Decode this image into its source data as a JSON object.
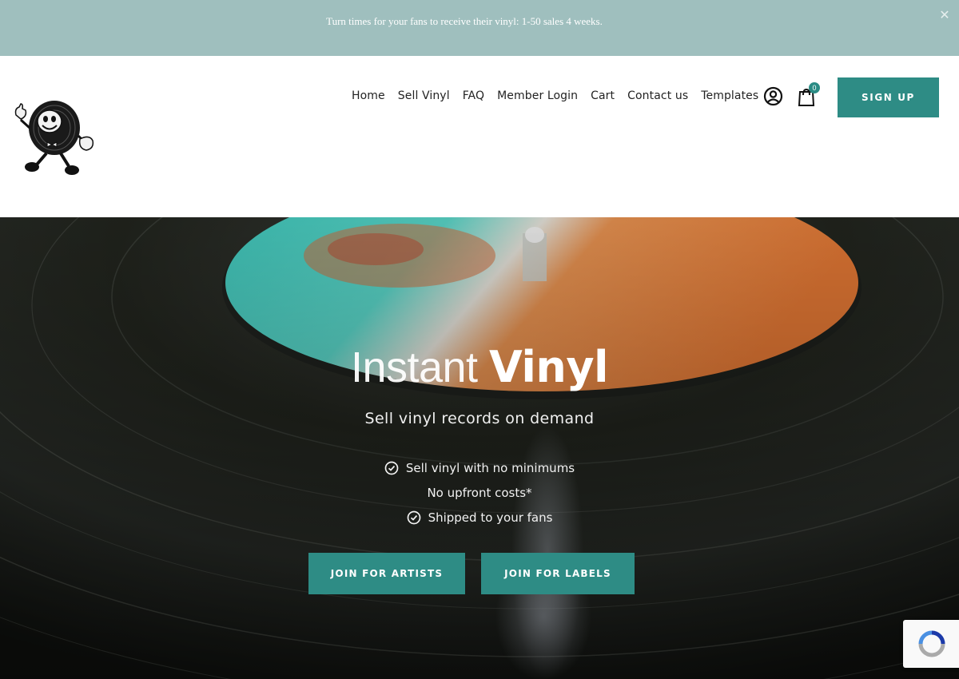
{
  "announcement": {
    "text": "Turn times for your fans to receive their vinyl: 1-50 sales 4 weeks.",
    "close_icon": "close-icon"
  },
  "header": {
    "logo": "record-mascot-logo",
    "nav": [
      "Home",
      "Sell Vinyl",
      "FAQ",
      "Member Login",
      "Cart",
      "Contact us",
      "Templates"
    ],
    "account_icon": "user-circle-icon",
    "cart_icon": "shopping-bag-icon",
    "cart_count": "0",
    "signup_label": "SIGN UP"
  },
  "hero": {
    "title_light": "Instant ",
    "title_bold": "Vinyl",
    "subtitle": "Sell vinyl records on demand",
    "features": [
      {
        "text": "Sell vinyl with no minimums",
        "check": true
      },
      {
        "text": "No upfront costs*",
        "check": false
      },
      {
        "text": "Shipped to your fans",
        "check": true
      }
    ],
    "button_artists": "JOIN FOR ARTISTS",
    "button_labels": "JOIN FOR LABELS"
  },
  "colors": {
    "accent": "#2e8c85",
    "announcement_bg": "#9fbfbe",
    "label_teal": "#4fd6c8",
    "label_orange": "#f08a45"
  }
}
